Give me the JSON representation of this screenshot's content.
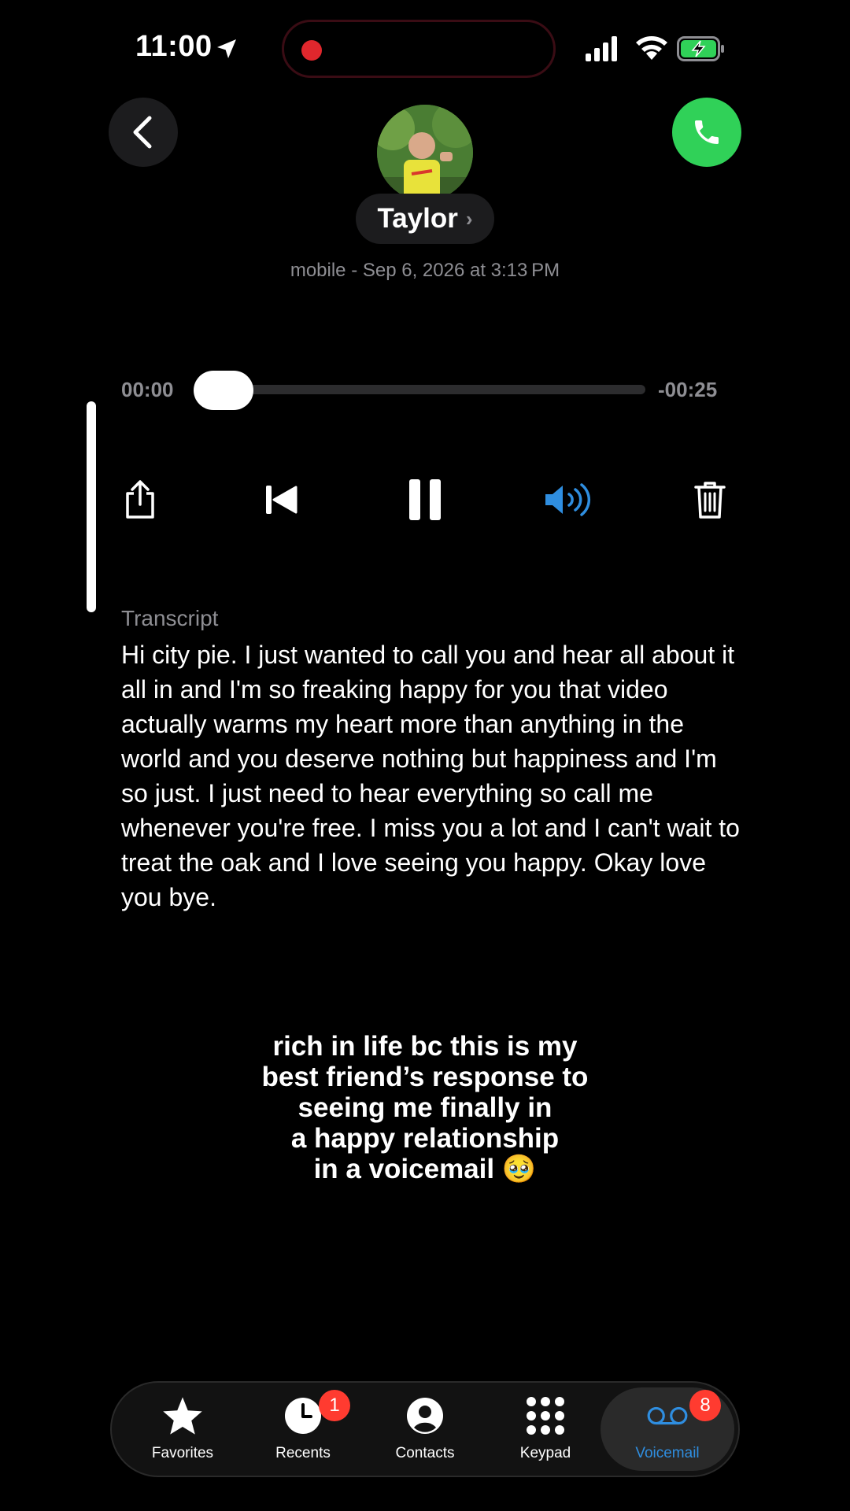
{
  "status_bar": {
    "time": "11:00",
    "icons": [
      "location-arrow-icon",
      "recording-dot-icon",
      "cellular-signal-icon",
      "wifi-icon",
      "battery-charging-icon"
    ],
    "recording_color": "#e0272d",
    "battery_color": "#30d158"
  },
  "header": {
    "contact_name": "Taylor",
    "name_chevron": "›",
    "subtitle": "mobile - Sep 6, 2026 at 3:13 PM",
    "call_button_color": "#30d158"
  },
  "player": {
    "elapsed": "00:00",
    "remaining": "-00:25",
    "progress": 0.0,
    "controls": [
      "share-icon",
      "skip-back-icon",
      "pause-icon",
      "speaker-icon",
      "trash-icon"
    ],
    "speaker_active_color": "#2f8ee0"
  },
  "transcript": {
    "label": "Transcript",
    "text": "Hi city pie. I just wanted to call you and hear all about it all in and I'm so freaking happy for you that video actually warms my heart more than anything in the world and you deserve nothing but happiness and I'm so just. I just need to hear everything so call me whenever you're free. I miss you a lot and I can't wait to treat the oak and I love seeing you happy. Okay love you bye."
  },
  "caption": {
    "text": "rich in life bc this is my\nbest friend’s response to\nseeing me finally in\na happy relationship\nin a voicemail 🥹"
  },
  "tab_bar": {
    "tabs": [
      {
        "label": "Favorites",
        "icon": "star-icon"
      },
      {
        "label": "Recents",
        "icon": "clock-icon",
        "badge": "1"
      },
      {
        "label": "Contacts",
        "icon": "person-circle-icon"
      },
      {
        "label": "Keypad",
        "icon": "keypad-icon"
      },
      {
        "label": "Voicemail",
        "icon": "voicemail-icon",
        "badge": "8",
        "selected": true
      }
    ],
    "selected_color": "#2f8ee0",
    "badge_color": "#ff3b30"
  }
}
